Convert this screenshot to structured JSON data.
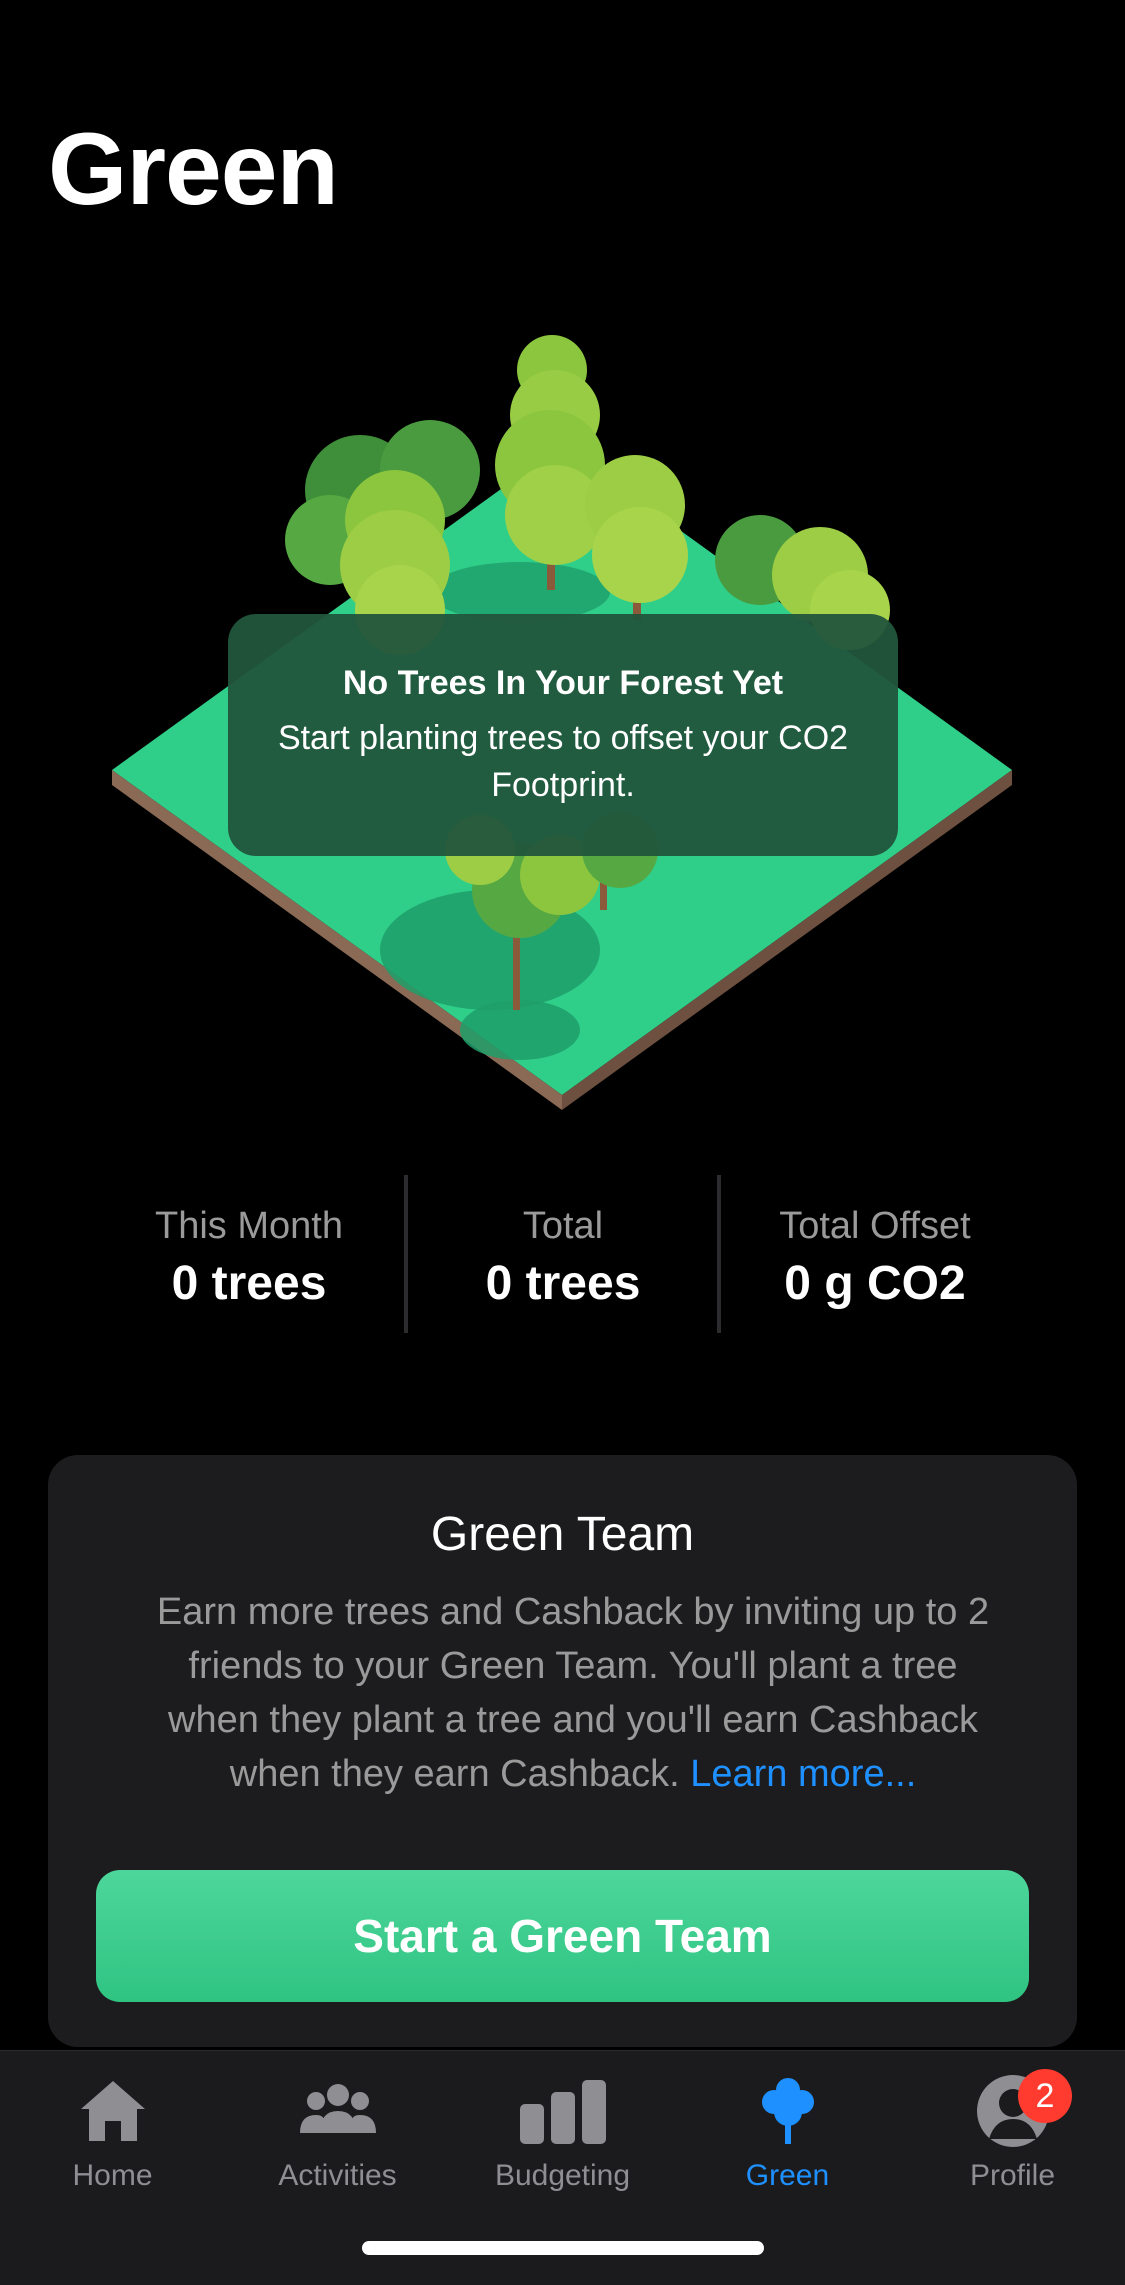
{
  "page": {
    "title": "Green"
  },
  "forest": {
    "tooltip_title": "No Trees In Your Forest Yet",
    "tooltip_body": "Start planting trees to offset your CO2 Footprint."
  },
  "stats": [
    {
      "label": "This Month",
      "value": "0 trees"
    },
    {
      "label": "Total",
      "value": "0 trees"
    },
    {
      "label": "Total Offset",
      "value": "0 g CO2"
    }
  ],
  "green_team": {
    "title": "Green Team",
    "body": "Earn more trees and Cashback by inviting up to 2 friends to your Green Team. You'll plant a tree when they plant a tree and you'll earn Cashback when they earn Cashback. ",
    "link": "Learn more...",
    "button": "Start a Green Team"
  },
  "tabbar": {
    "items": [
      {
        "label": "Home",
        "icon": "home-icon"
      },
      {
        "label": "Activities",
        "icon": "people-icon"
      },
      {
        "label": "Budgeting",
        "icon": "bar-chart-icon"
      },
      {
        "label": "Green",
        "icon": "tree-icon",
        "active": true
      },
      {
        "label": "Profile",
        "icon": "avatar-icon",
        "badge": "2"
      }
    ]
  },
  "colors": {
    "accent": "#1e90ff",
    "cta_green": "#3ccd8c",
    "badge_red": "#ff3b30",
    "tooltip_bg": "#22553c"
  }
}
